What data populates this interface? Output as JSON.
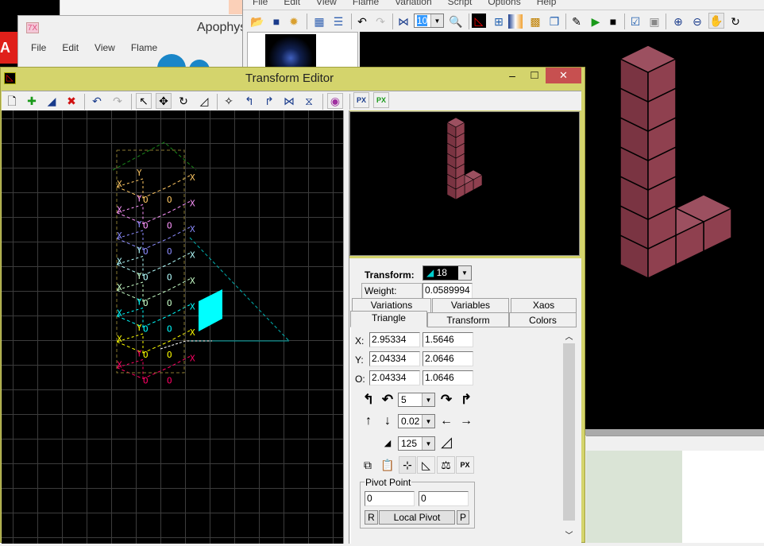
{
  "main_window": {
    "menu": [
      "File",
      "Edit",
      "View",
      "Flame",
      "Variation",
      "Script",
      "Options",
      "Help"
    ],
    "toolbar": {
      "render_quality_value": "10"
    },
    "icons": [
      "open-icon",
      "save-icon",
      "render-gear-icon",
      "list-view-icon",
      "options-list-icon",
      "undo-icon",
      "redo-icon",
      "flip-icon",
      "quality-combo",
      "explorer-icon",
      "transform-editor-icon",
      "adjust-icon",
      "gradient-icon",
      "mutate-icon",
      "window-icon",
      "edit-script-icon",
      "play-icon",
      "stop-icon",
      "checklist-icon",
      "transparency-icon",
      "zoom-in-icon",
      "zoom-out-icon",
      "hand-icon",
      "rotate-icon"
    ]
  },
  "apophysis_window": {
    "title": "Apophys",
    "logo": "7X",
    "menu": [
      "File",
      "Edit",
      "View",
      "Flame"
    ]
  },
  "transform_editor": {
    "title": "Transform Editor",
    "title_buttons": {
      "minimize": "‒",
      "maximize": "□",
      "close": "✕"
    },
    "transform_label": "Transform:",
    "transform_value": "18",
    "weight_label": "Weight:",
    "weight_value": "0.0589994",
    "tabs_row1": [
      "Variations",
      "Variables",
      "Xaos"
    ],
    "tabs_row2": [
      "Triangle",
      "Transform",
      "Colors"
    ],
    "active_tab": "Triangle",
    "triangle": {
      "rows": [
        {
          "label": "X:",
          "a": "2.95334",
          "b": "1.5646"
        },
        {
          "label": "Y:",
          "a": "2.04334",
          "b": "2.0646"
        },
        {
          "label": "O:",
          "a": "2.04334",
          "b": "1.0646"
        }
      ],
      "rotate_value": "5",
      "move_value": "0.02",
      "scale_value": "125"
    },
    "pivot": {
      "title": "Pivot Point",
      "x": "0",
      "y": "0",
      "reset_label": "R",
      "mode_label": "Local Pivot",
      "pick_label": "P"
    },
    "colors": {
      "title_bar": "#d4d46c",
      "close": "#c75050",
      "selected_transform": "#00ffff",
      "cube": "#8b3a4a"
    },
    "transform_colors": [
      "#ffc864",
      "#ff96ff",
      "#8c8cff",
      "#b4ffff",
      "#c8ffc8",
      "#00ffff",
      "#ffff00",
      "#ff0064",
      "#ff8c00",
      "#ff00ff",
      "#0000ff",
      "#00ff00",
      "#ff0000",
      "#ffffff"
    ]
  }
}
